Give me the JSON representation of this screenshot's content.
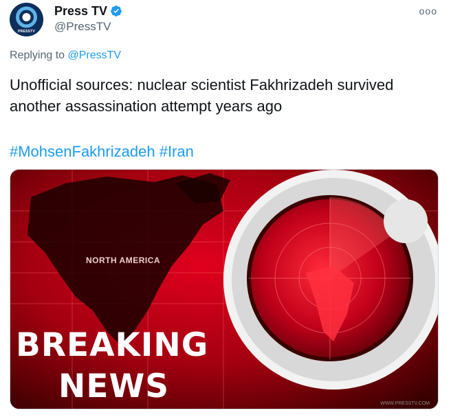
{
  "account": {
    "display_name": "Press TV",
    "handle": "@PressTV",
    "avatar_text": "PRESSTV",
    "verified_icon": "verified-badge-icon"
  },
  "more_label": "ooo",
  "reply": {
    "prefix": "Replying to ",
    "target": "@PressTV"
  },
  "tweet": {
    "text": "Unofficial sources: nuclear scientist Fakhrizadeh survived another assassination attempt years ago",
    "hashtags": [
      "#MohsenFakhrizadeh",
      "#Iran"
    ]
  },
  "media": {
    "map_label": "NORTH AMERICA",
    "headline_line1": "BREAKING",
    "headline_line2": "NEWS",
    "watermark": "WWW.PRESSTV.COM"
  },
  "colors": {
    "link": "#1d9bf0",
    "text": "#0f1419",
    "muted": "#536471",
    "media_red": "#c4001a"
  }
}
